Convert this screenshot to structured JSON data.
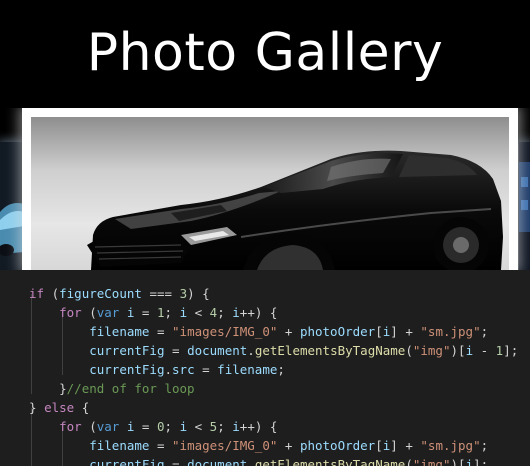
{
  "header": {
    "title": "Photo Gallery"
  },
  "gallery": {
    "main_photo_icon": "car-photo",
    "side_photo_icon": "car-photo",
    "frame_color": "#ffffff"
  },
  "code": {
    "theme_background": "#1e1e1e",
    "lines": [
      "if (figureCount === 3) {",
      "    for (var i = 1; i < 4; i++) {",
      "        filename = \"images/IMG_0\" + photoOrder[i] + \"sm.jpg\";",
      "        currentFig = document.getElementsByTagName(\"img\")[i - 1];",
      "        currentFig.src = filename;",
      "    }//end of for loop",
      "} else {",
      "    for (var i = 0; i < 5; i++) {",
      "        filename = \"images/IMG_0\" + photoOrder[i] + \"sm.jpg\";",
      "        currentFig = document.getElementsByTagName(\"img\")[i];"
    ]
  }
}
